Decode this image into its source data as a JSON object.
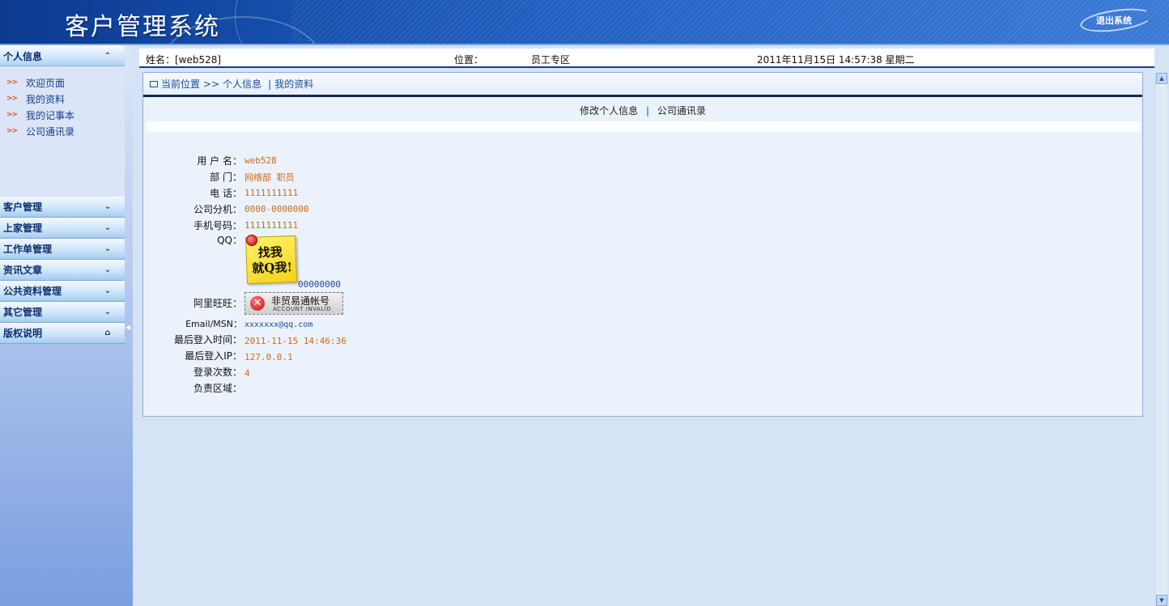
{
  "header": {
    "title": "客户管理系统",
    "logout_label": "退出系统"
  },
  "sidebar": {
    "personal": {
      "label": "个人信息",
      "toggle": "⌃",
      "links": [
        {
          "bullet": ">>",
          "label": "欢迎页面"
        },
        {
          "bullet": ">>",
          "label": "我的资料"
        },
        {
          "bullet": ">>",
          "label": "我的记事本"
        },
        {
          "bullet": ">>",
          "label": "公司通讯录"
        }
      ]
    },
    "sections": [
      {
        "label": "客户管理",
        "toggle": "⌄"
      },
      {
        "label": "上家管理",
        "toggle": "⌄"
      },
      {
        "label": "工作单管理",
        "toggle": "⌄"
      },
      {
        "label": "资讯文章",
        "toggle": "⌄"
      },
      {
        "label": "公共资料管理",
        "toggle": "⌄"
      },
      {
        "label": "其它管理",
        "toggle": "⌄"
      },
      {
        "label": "版权说明",
        "toggle": "⌂"
      }
    ]
  },
  "infobar": {
    "name": "姓名：[web528]",
    "position_label": "位置：",
    "position_value": "员工专区",
    "datetime": "2011年11月15日 14:57:38 星期二"
  },
  "breadcrumb": {
    "prefix": "当前位置",
    "separator": ">>",
    "section": "个人信息",
    "divider": "|",
    "page": "我的资料"
  },
  "tabs": {
    "edit": "修改个人信息",
    "sep": "|",
    "directory": "公司通讯录"
  },
  "profile": {
    "username_label": "用 户 名：",
    "username": "web528",
    "dept_label": "部    门：",
    "dept": "网络部 职员",
    "phone_label": "电    话：",
    "phone": "1111111111",
    "ext_label": "公司分机：",
    "ext": "0000-0000000",
    "mobile_label": "手机号码：",
    "mobile": "1111111111",
    "qq_label": "QQ：",
    "qq_badge_line1": "找我",
    "qq_badge_line2": "就Q我!",
    "qq": "00000000",
    "ali_label": "阿里旺旺：",
    "ali_badge_text": "非贸易通帐号",
    "ali_badge_sub": "ACCOUNT INVALID",
    "email_label": "Email/MSN：",
    "email": "xxxxxxx@qq.com",
    "last_login_label": "最后登入时间：",
    "last_login": "2011-11-15 14:46:36",
    "last_ip_label": "最后登入IP：",
    "last_ip": "127.0.0.1",
    "login_count_label": "登录次数：",
    "login_count": "4",
    "region_label": "负责区域：",
    "region": ""
  }
}
